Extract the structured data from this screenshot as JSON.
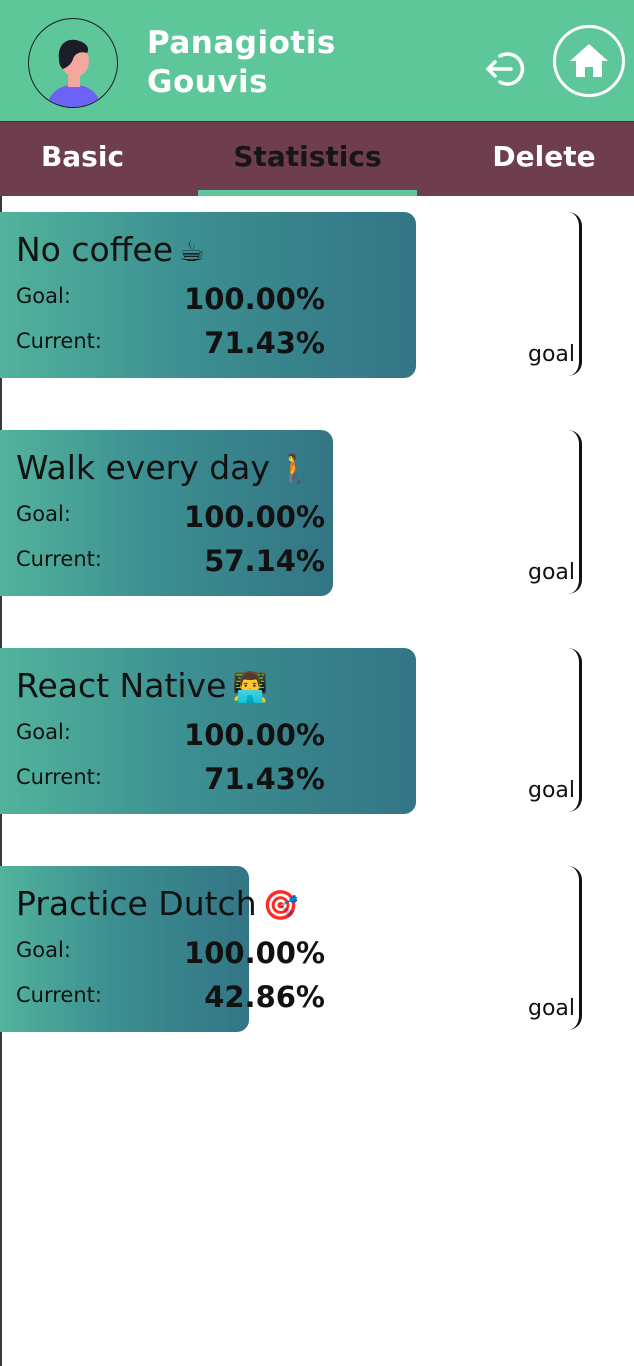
{
  "user": {
    "name": "Panagiotis\nGouvis"
  },
  "icons": {
    "avatar": "user-avatar-icon",
    "logout": "logout-icon",
    "home": "home-icon"
  },
  "colors": {
    "header": "#5ec79a",
    "tabbar": "#6e3d4e",
    "bar_start": "#52b39c",
    "bar_end": "#337585"
  },
  "tabs": [
    {
      "label": "Basic"
    },
    {
      "label": "Statistics"
    },
    {
      "label": "Delete"
    }
  ],
  "active_tab": "Statistics",
  "habits": [
    {
      "title": "No coffee",
      "emoji": "☕",
      "goal_label": "Goal:",
      "goal_value": "100.00%",
      "current_label": "Current:",
      "current_value": "71.43%",
      "progress_pct": 71.43,
      "marker_label": "goal"
    },
    {
      "title": "Walk every day",
      "emoji": "🚶",
      "goal_label": "Goal:",
      "goal_value": "100.00%",
      "current_label": "Current:",
      "current_value": "57.14%",
      "progress_pct": 57.14,
      "marker_label": "goal"
    },
    {
      "title": "React Native",
      "emoji": "👨‍💻",
      "goal_label": "Goal:",
      "goal_value": "100.00%",
      "current_label": "Current:",
      "current_value": "71.43%",
      "progress_pct": 71.43,
      "marker_label": "goal"
    },
    {
      "title": "Practice Dutch",
      "emoji": "🎯",
      "goal_label": "Goal:",
      "goal_value": "100.00%",
      "current_label": "Current:",
      "current_value": "42.86%",
      "progress_pct": 42.86,
      "marker_label": "goal"
    }
  ]
}
